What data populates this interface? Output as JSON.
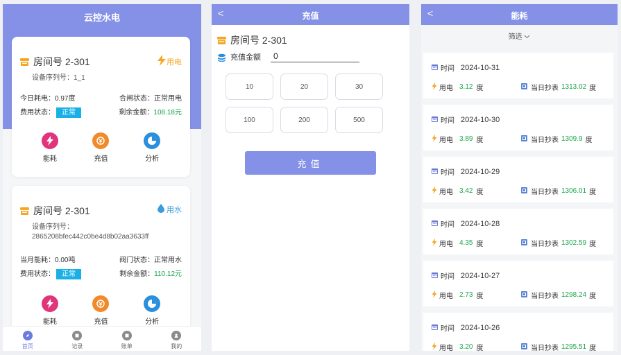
{
  "screen1": {
    "title": "云控水电",
    "card1": {
      "room": "房间号  2-301",
      "type_label": "用电",
      "serial": "设备序列号：1_1",
      "usage_label": "今日耗电：0.97度",
      "contract_label": "合闸状态：正常用电",
      "fee_label": "费用状态：",
      "fee_badge": "正常",
      "balance_label": "剩余金额：",
      "balance_value": "108.18元",
      "actions": [
        "能耗",
        "充值",
        "分析"
      ]
    },
    "card2": {
      "room": "房间号  2-301",
      "type_label": "用水",
      "serial_label": "设备序列号：",
      "serial_value": "2865208bfec442c0be4d8b02aa3633ff",
      "usage_label": "当月能耗：0.00吨",
      "valve_label": "阀门状态：正常用水",
      "fee_label": "费用状态：",
      "fee_badge": "正常",
      "balance_label": "剩余金额：",
      "balance_value": "110.12元",
      "actions": [
        "能耗",
        "充值",
        "分析"
      ]
    },
    "tabs": [
      "首页",
      "记录",
      "账单",
      "我的"
    ]
  },
  "screen2": {
    "title": "充值",
    "back": "<",
    "room": "房间号  2-301",
    "amount_label": "充值金额",
    "amount_value": "0",
    "amounts": [
      "10",
      "20",
      "30",
      "100",
      "200",
      "500"
    ],
    "submit": "充值"
  },
  "screen3": {
    "title": "能耗",
    "back": "<",
    "filter": "筛选",
    "time_label": "时间",
    "elec_label": "用电",
    "meter_label": "当日抄表",
    "records": [
      {
        "date": "2024-10-31",
        "usage": "3.12",
        "unit": "度",
        "meter": "1313.02",
        "meter_unit": "度"
      },
      {
        "date": "2024-10-30",
        "usage": "3.89",
        "unit": "度",
        "meter": "1309.9",
        "meter_unit": "度"
      },
      {
        "date": "2024-10-29",
        "usage": "3.42",
        "unit": "度",
        "meter": "1306.01",
        "meter_unit": "度"
      },
      {
        "date": "2024-10-28",
        "usage": "4.35",
        "unit": "度",
        "meter": "1302.59",
        "meter_unit": "度"
      },
      {
        "date": "2024-10-27",
        "usage": "2.73",
        "unit": "度",
        "meter": "1298.24",
        "meter_unit": "度"
      },
      {
        "date": "2024-10-26",
        "usage": "3.20",
        "unit": "度",
        "meter": "1295.51",
        "meter_unit": "度"
      }
    ]
  },
  "colors": {
    "primary": "#8491e6",
    "accent_green": "#17a34a",
    "badge_blue": "#18b0e6",
    "elec_orange": "#f5a623",
    "water_blue": "#3b9be0"
  }
}
